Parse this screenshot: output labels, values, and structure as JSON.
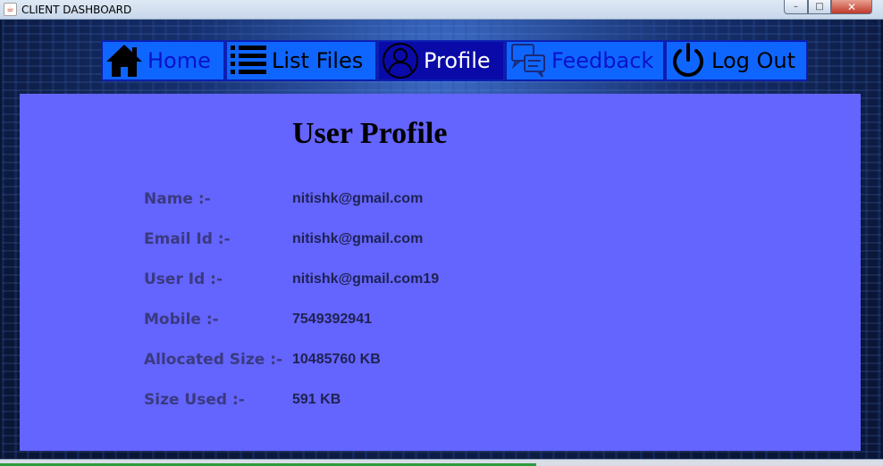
{
  "window": {
    "title": "CLIENT DASHBOARD",
    "app_icon": "java-icon",
    "controls": {
      "minimize": "–",
      "maximize": "□",
      "close": "✕"
    }
  },
  "nav": {
    "items": [
      {
        "label": "Home",
        "icon": "home-icon"
      },
      {
        "label": "List Files",
        "icon": "list-icon"
      },
      {
        "label": "Profile",
        "icon": "user-icon",
        "active": true
      },
      {
        "label": "Feedback",
        "icon": "feedback-icon"
      },
      {
        "label": "Log Out",
        "icon": "power-icon"
      }
    ]
  },
  "profile": {
    "title": "User Profile",
    "fields": [
      {
        "label": "Name :-",
        "value": "nitishk@gmail.com"
      },
      {
        "label": "Email Id :-",
        "value": "nitishk@gmail.com"
      },
      {
        "label": "User Id :-",
        "value": "nitishk@gmail.com19"
      },
      {
        "label": "Mobile :-",
        "value": "7549392941"
      },
      {
        "label": "Allocated Size :-",
        "value": "10485760 KB"
      },
      {
        "label": "Size Used :-",
        "value": "591 KB"
      }
    ]
  },
  "colors": {
    "panel": "#6464ff",
    "nav_button": "#0f66ff",
    "nav_active": "#0a0aa8"
  }
}
